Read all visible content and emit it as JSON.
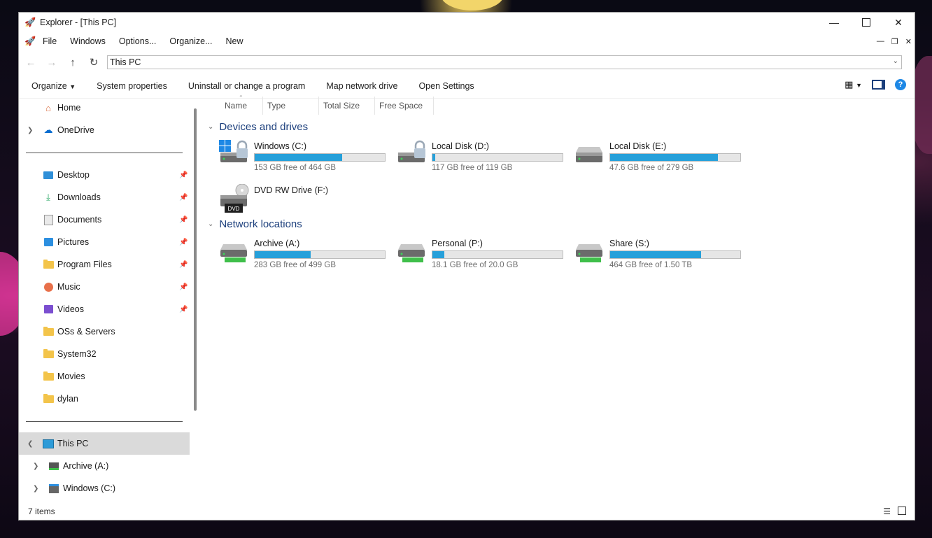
{
  "window": {
    "title": "Explorer - [This PC]"
  },
  "menu": {
    "items": [
      "File",
      "Windows",
      "Options...",
      "Organize...",
      "New"
    ]
  },
  "address": {
    "path": "This PC"
  },
  "toolbar": {
    "organize": "Organize",
    "items": [
      "System properties",
      "Uninstall or change a program",
      "Map network drive",
      "Open Settings"
    ]
  },
  "sidebar": {
    "top": [
      {
        "label": "Home"
      },
      {
        "label": "OneDrive"
      }
    ],
    "quick": [
      {
        "label": "Desktop"
      },
      {
        "label": "Downloads"
      },
      {
        "label": "Documents"
      },
      {
        "label": "Pictures"
      },
      {
        "label": "Program Files"
      },
      {
        "label": "Music"
      },
      {
        "label": "Videos"
      },
      {
        "label": "OSs & Servers"
      },
      {
        "label": "System32"
      },
      {
        "label": "Movies"
      },
      {
        "label": "dylan"
      }
    ],
    "this_pc": "This PC",
    "sub": [
      {
        "label": "Archive (A:)"
      },
      {
        "label": "Windows (C:)"
      }
    ]
  },
  "columns": [
    "Name",
    "Type",
    "Total Size",
    "Free Space"
  ],
  "groups": {
    "devices": {
      "title": "Devices and drives",
      "drives": [
        {
          "name": "Windows (C:)",
          "free": "153 GB free of 464 GB",
          "used_fraction": 0.67
        },
        {
          "name": "Local Disk (D:)",
          "free": "117 GB free of 119 GB",
          "used_fraction": 0.02
        },
        {
          "name": "Local Disk (E:)",
          "free": "47.6 GB free of 279 GB",
          "used_fraction": 0.83
        },
        {
          "name": "DVD RW Drive (F:)"
        }
      ]
    },
    "network": {
      "title": "Network locations",
      "drives": [
        {
          "name": "Archive (A:)",
          "free": "283 GB free of 499 GB",
          "used_fraction": 0.43
        },
        {
          "name": "Personal (P:)",
          "free": "18.1 GB free of 20.0 GB",
          "used_fraction": 0.09
        },
        {
          "name": "Share (S:)",
          "free": "464 GB free of 1.50 TB",
          "used_fraction": 0.7
        }
      ]
    }
  },
  "dvd_label": "DVD",
  "status": {
    "count": "7 items"
  },
  "colors": {
    "bar_fill": "#26a0da",
    "group_title": "#1c3f7c",
    "selected_bg": "#dadada"
  }
}
